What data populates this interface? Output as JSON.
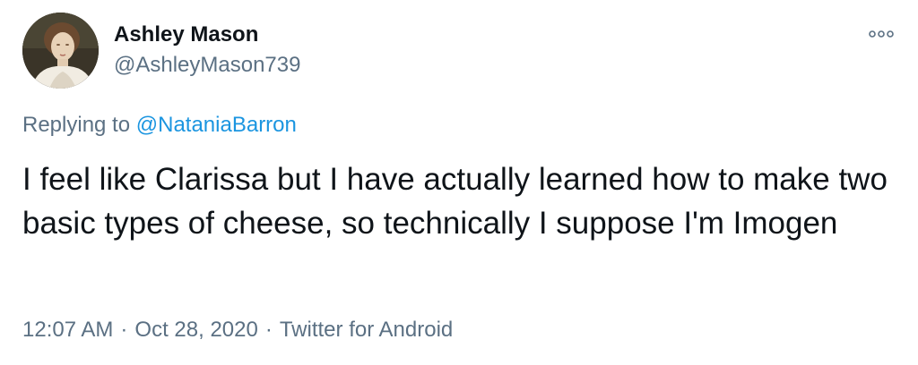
{
  "tweet": {
    "author": {
      "name": "Ashley Mason",
      "handle": "@AshleyMason739"
    },
    "reply": {
      "prefix": "Replying to",
      "mention": "@NataniaBarron"
    },
    "text": "I feel like Clarissa but I have actually learned how to make two basic types of cheese, so technically I suppose I'm Imogen",
    "meta": {
      "time": "12:07 AM",
      "separator": "·",
      "date": "Oct 28, 2020",
      "source": "Twitter for Android"
    }
  },
  "icons": {
    "avatar": "portrait-avatar",
    "more": "more-options-icon"
  },
  "colors": {
    "text": "#0f1419",
    "secondary": "#5b7083",
    "link": "#1b95e0",
    "background": "#ffffff"
  }
}
